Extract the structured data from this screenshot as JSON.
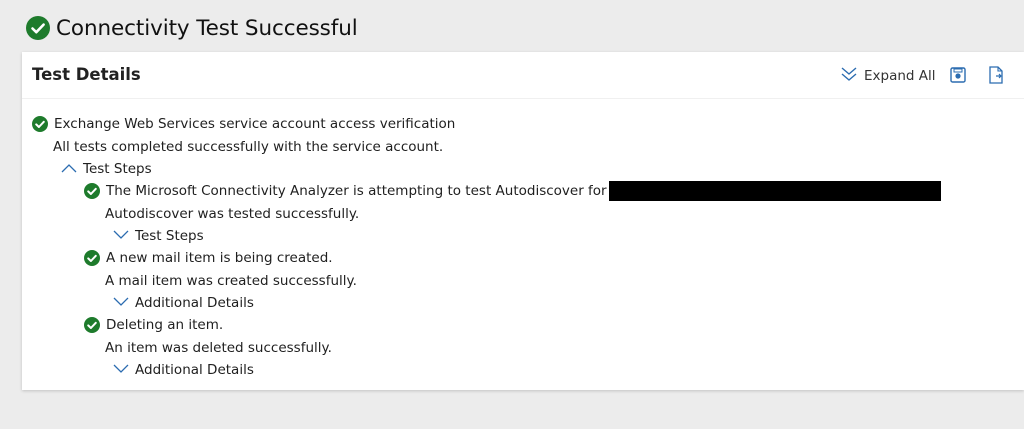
{
  "page": {
    "title": "Connectivity Test Successful"
  },
  "card": {
    "title": "Test Details",
    "expand_all_label": "Expand All",
    "icons": {
      "status": "check-circle-icon",
      "expand_all": "double-chevron-down-icon",
      "save": "save-report-icon",
      "export": "export-document-icon",
      "collapse": "chevron-up-icon",
      "expand": "chevron-down-icon"
    },
    "colors": {
      "success": "#1e7b2c",
      "accent": "#2b6cb0"
    }
  },
  "tree": {
    "root": {
      "title": "Exchange Web Services service account access verification",
      "detail": "All tests completed successfully with the service account.",
      "toggle_label": "Test Steps",
      "steps": [
        {
          "title": "The Microsoft Connectivity Analyzer is attempting to test Autodiscover for",
          "detail": "Autodiscover was tested successfully.",
          "toggle_label": "Test Steps"
        },
        {
          "title": "A new mail item is being created.",
          "detail": "A mail item was created successfully.",
          "toggle_label": "Additional Details"
        },
        {
          "title": "Deleting an item.",
          "detail": "An item was deleted successfully.",
          "toggle_label": "Additional Details"
        }
      ]
    }
  }
}
